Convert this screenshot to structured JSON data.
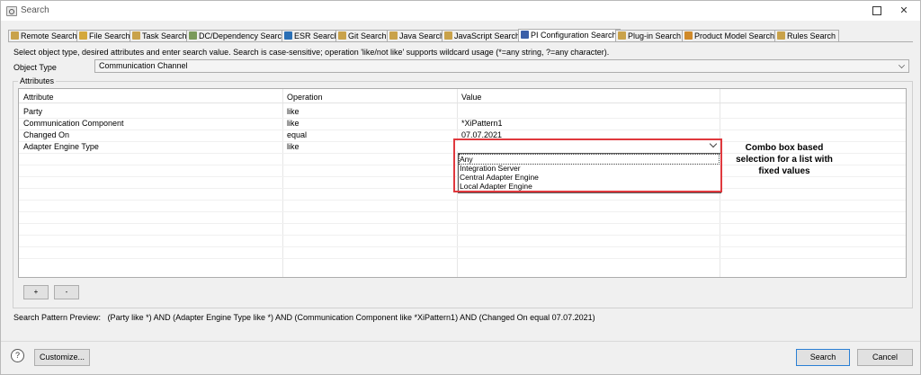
{
  "window": {
    "title": "Search"
  },
  "tabs": [
    {
      "label": "Remote Search",
      "icon": "remote-search-icon",
      "color": "#c9a24a"
    },
    {
      "label": "File Search",
      "icon": "file-search-icon",
      "color": "#d4a83a"
    },
    {
      "label": "Task Search",
      "icon": "task-search-icon",
      "color": "#c9a24a"
    },
    {
      "label": "DC/Dependency Search",
      "icon": "dependency-search-icon",
      "color": "#7a9a5a"
    },
    {
      "label": "ESR Search",
      "icon": "esr-search-icon",
      "color": "#2a6fb5"
    },
    {
      "label": "Git Search",
      "icon": "git-search-icon",
      "color": "#c9a24a"
    },
    {
      "label": "Java Search",
      "icon": "java-search-icon",
      "color": "#c9a24a"
    },
    {
      "label": "JavaScript Search",
      "icon": "javascript-search-icon",
      "color": "#c9a24a"
    },
    {
      "label": "PI Configuration Search",
      "icon": "pi-config-search-icon",
      "color": "#3a5fa8"
    },
    {
      "label": "Plug-in Search",
      "icon": "plugin-search-icon",
      "color": "#c9a24a"
    },
    {
      "label": "Product Model Search",
      "icon": "product-model-search-icon",
      "color": "#d08a2a"
    },
    {
      "label": "Rules Search",
      "icon": "rules-search-icon",
      "color": "#c9a24a"
    }
  ],
  "instructions": "Select object type, desired attributes and enter search value. Search is case-sensitive; operation 'like/not like' supports wildcard usage (*=any string, ?=any character).",
  "object_type": {
    "label": "Object Type",
    "value": "Communication Channel"
  },
  "attributes": {
    "group_label": "Attributes",
    "columns": [
      "Attribute",
      "Operation",
      "Value"
    ],
    "rows": [
      {
        "attribute": "Party",
        "operation": "like",
        "value": ""
      },
      {
        "attribute": "Communication Component",
        "operation": "like",
        "value": "*XiPattern1"
      },
      {
        "attribute": "Changed On",
        "operation": "equal",
        "value": "07.07.2021"
      },
      {
        "attribute": "Adapter Engine Type",
        "operation": "like",
        "value": ""
      }
    ],
    "dropdown_options": [
      "Any",
      "Integration Server",
      "Central Adapter Engine",
      "Local Adapter Engine"
    ]
  },
  "annotation": "Combo box based selection for a list with fixed values",
  "buttons": {
    "add": "+",
    "remove": "-",
    "customize": "Customize...",
    "search": "Search",
    "cancel": "Cancel",
    "help": "?"
  },
  "preview": {
    "label": "Search Pattern Preview:",
    "text": "(Party like *) AND (Adapter Engine Type like *) AND (Communication Component like *XiPattern1) AND (Changed On equal 07.07.2021)"
  },
  "colors": {
    "highlight": "#e0393e",
    "default_button_border": "#2a7fd4"
  }
}
